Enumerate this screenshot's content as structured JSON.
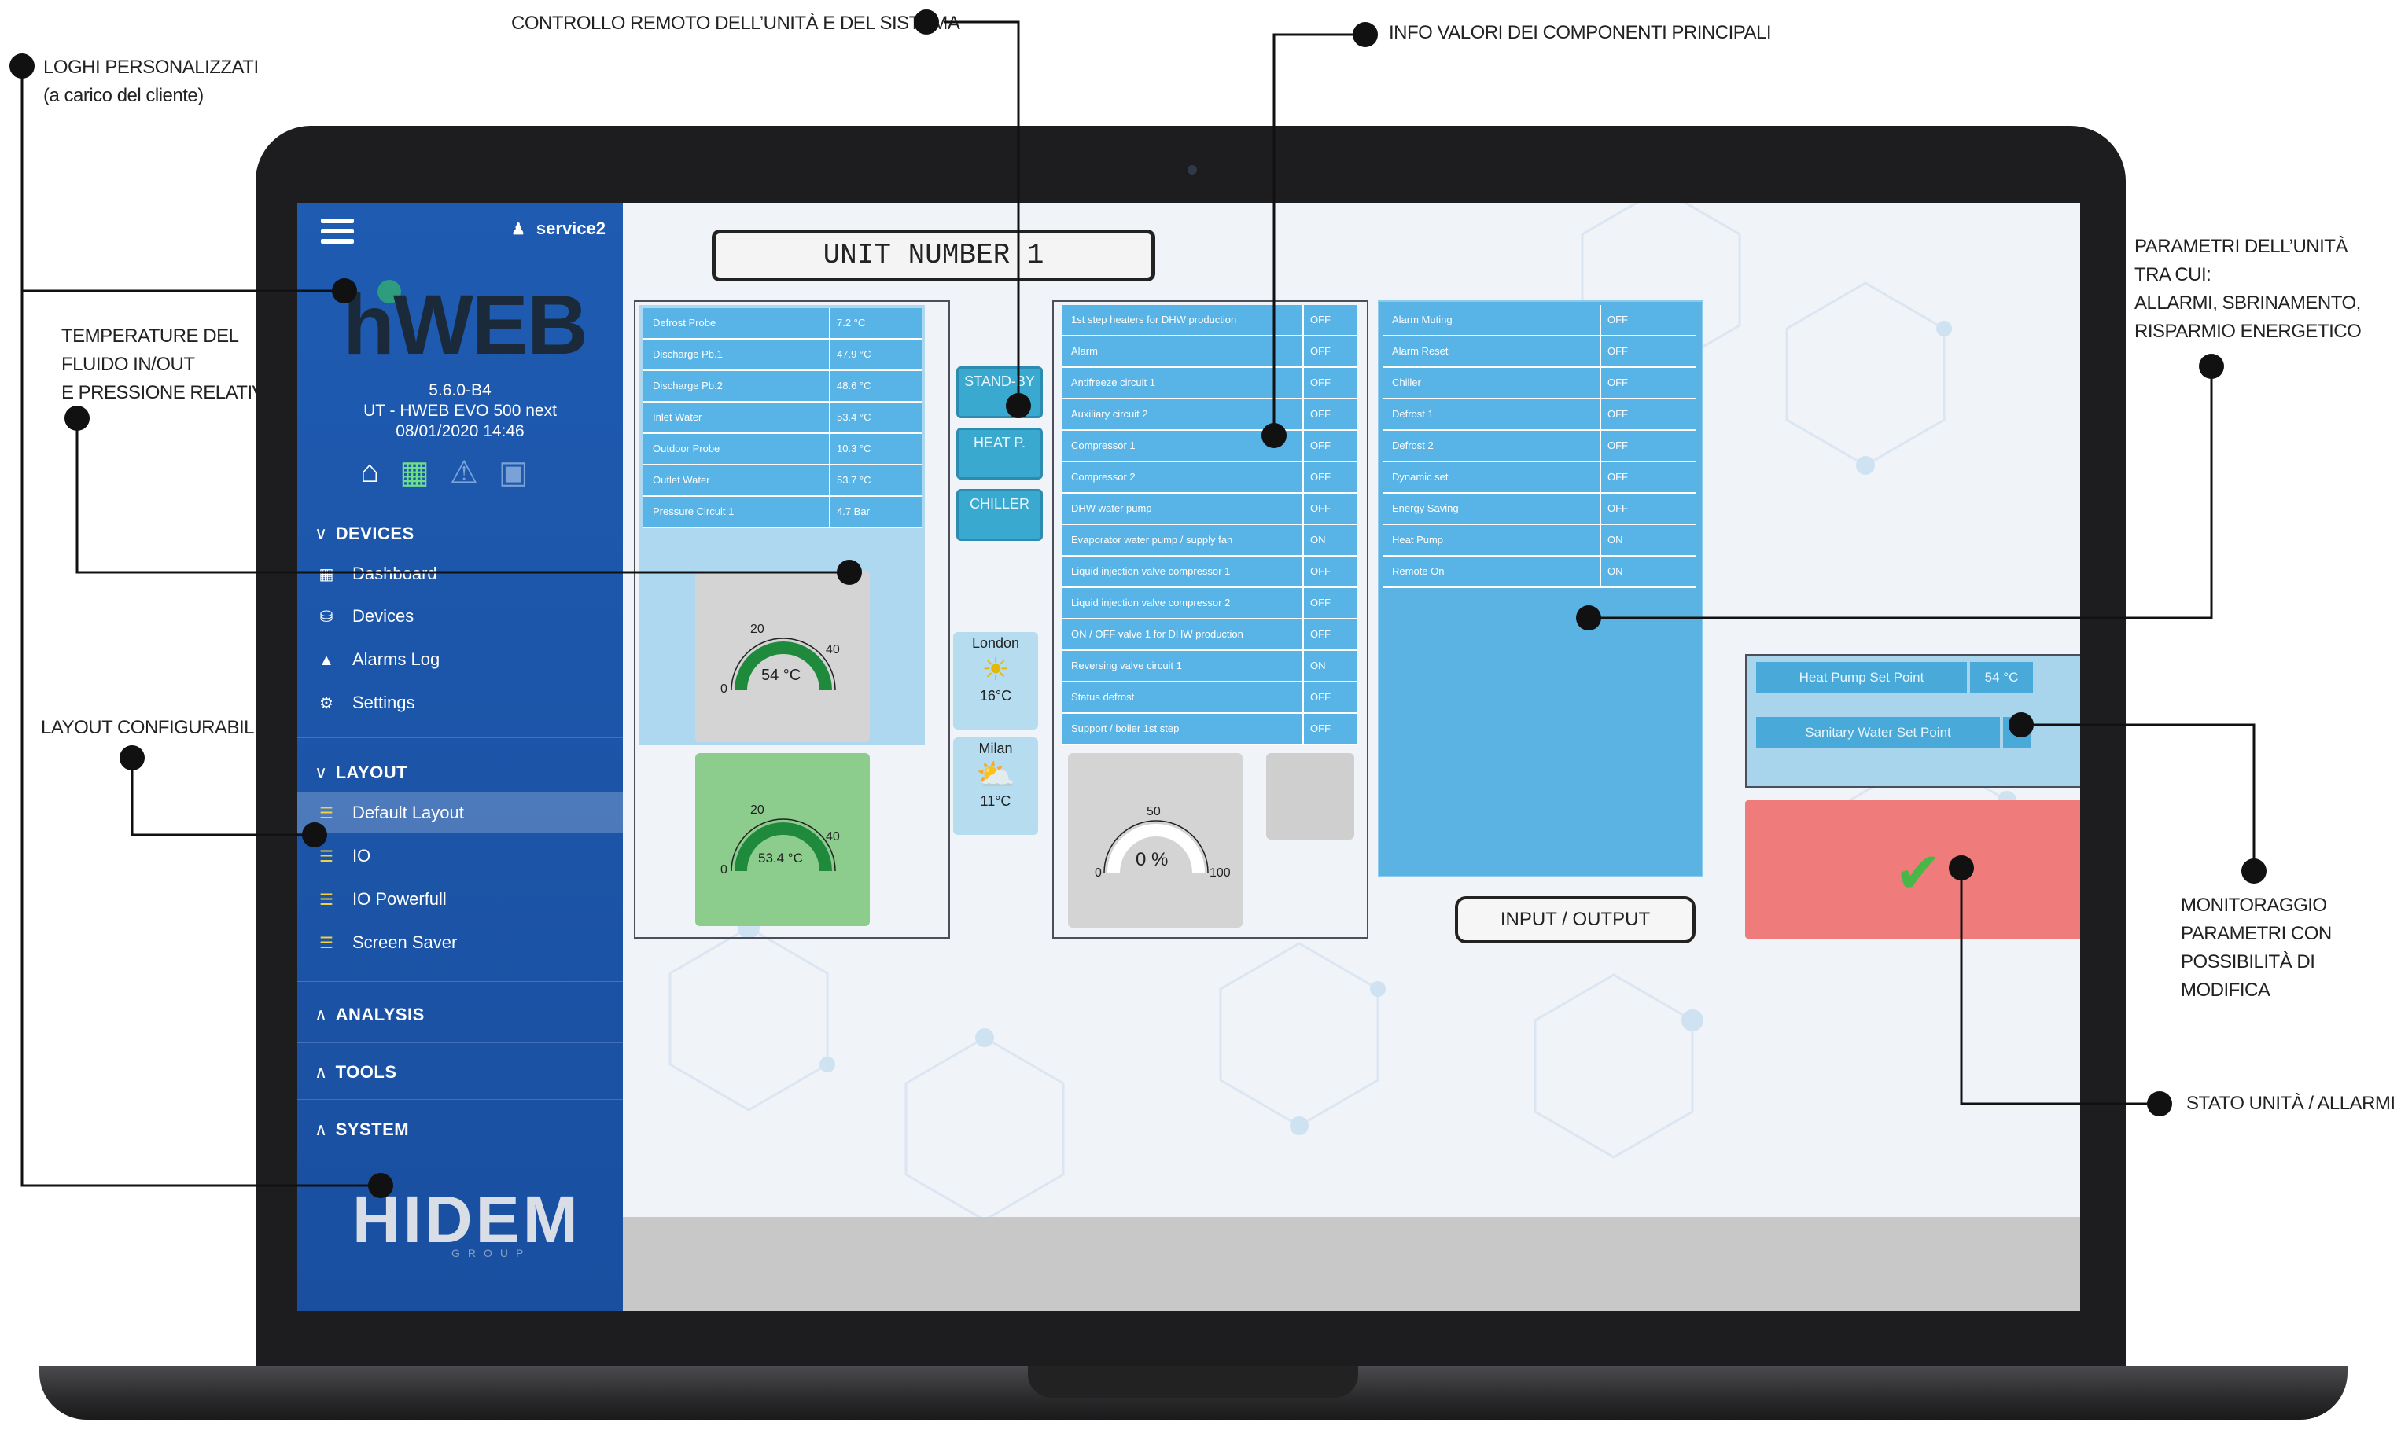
{
  "callouts": {
    "loghi_line1": "LOGHI PERSONALIZZATI",
    "loghi_line2": "(a carico del cliente)",
    "controllo": "CONTROLLO REMOTO DELL’UNITÀ E DEL  SISTEMA",
    "info": "INFO VALORI DEI COMPONENTI PRINCIPALI",
    "temperature": "TEMPERATURE DEL\nFLUIDO IN/OUT\nE PRESSIONE RELATIVA",
    "layout": "LAYOUT CONFIGURABILE",
    "parametri": "PARAMETRI DELL’UNITÀ\nTRA CUI:\nALLARMI, SBRINAMENTO,\nRISPARMIO ENERGETICO",
    "monitoraggio": "MONITORAGGIO\n PARAMETRI CON\nPOSSIBILITÀ DI MODIFICA",
    "stato": "STATO UNITÀ / ALLARMI"
  },
  "sidebar": {
    "user": "service2",
    "logo": "hWEB",
    "version": "5.6.0-B4",
    "device": "UT - HWEB EVO 500 next",
    "datetime": "08/01/2020 14:46",
    "quick_icons": [
      "home-icon",
      "monitor-chart-icon",
      "warning-icon",
      "lock-icon"
    ],
    "devices_section": "DEVICES",
    "devices_items": [
      "Dashboard",
      "Devices",
      "Alarms Log",
      "Settings"
    ],
    "layout_section": "LAYOUT",
    "layout_items": [
      "Default Layout",
      "IO",
      "IO Powerfull",
      "Screen Saver"
    ],
    "analysis": "ANALYSIS",
    "tools": "TOOLS",
    "system": "SYSTEM",
    "footer_logo": "HIDEM",
    "footer_sub": "GROUP"
  },
  "main": {
    "unit_title": "UNIT NUMBER 1",
    "probes": [
      {
        "name": "Defrost Probe",
        "value": "7.2 °C"
      },
      {
        "name": "Discharge Pb.1",
        "value": "47.9 °C"
      },
      {
        "name": "Discharge Pb.2",
        "value": "48.6 °C"
      },
      {
        "name": "Inlet Water",
        "value": "53.4 °C"
      },
      {
        "name": "Outdoor Probe",
        "value": "10.3 °C"
      },
      {
        "name": "Outlet Water",
        "value": "53.7 °C"
      },
      {
        "name": "Pressure Circuit 1",
        "value": "4.7 Bar"
      }
    ],
    "gauge1": {
      "value": 54,
      "display": "54 °C",
      "min": "0",
      "mid": "20",
      "max": "40"
    },
    "gauge2": {
      "value": 53.4,
      "display": "53.4 °C",
      "min": "0",
      "mid": "20",
      "max": "40"
    },
    "gauge3": {
      "value": 0,
      "display": "0 %",
      "min": "0",
      "mid": "50",
      "max": "100"
    },
    "buttons": [
      "STAND-BY",
      "HEAT P.",
      "CHILLER"
    ],
    "weather": [
      {
        "city": "London",
        "temp": "16°C",
        "icon": "sun-icon"
      },
      {
        "city": "Milan",
        "temp": "11°C",
        "icon": "sun-cloud-icon"
      }
    ],
    "components": [
      {
        "name": "1st step heaters for DHW production",
        "value": "OFF"
      },
      {
        "name": "Alarm",
        "value": "OFF"
      },
      {
        "name": "Antifreeze circuit 1",
        "value": "OFF"
      },
      {
        "name": "Auxiliary circuit 2",
        "value": "OFF"
      },
      {
        "name": "Compressor 1",
        "value": "OFF"
      },
      {
        "name": "Compressor 2",
        "value": "OFF"
      },
      {
        "name": "DHW water pump",
        "value": "OFF"
      },
      {
        "name": "Evaporator water pump / supply fan",
        "value": "ON"
      },
      {
        "name": "Liquid injection valve compressor 1",
        "value": "OFF"
      },
      {
        "name": "Liquid injection valve compressor 2",
        "value": "OFF"
      },
      {
        "name": "ON / OFF valve 1 for DHW production",
        "value": "OFF"
      },
      {
        "name": "Reversing valve circuit 1",
        "value": "ON"
      },
      {
        "name": "Status defrost",
        "value": "OFF"
      },
      {
        "name": "Support / boiler 1st step",
        "value": "OFF"
      }
    ],
    "unit_params": [
      {
        "name": "Alarm Muting",
        "value": "OFF"
      },
      {
        "name": "Alarm Reset",
        "value": "OFF"
      },
      {
        "name": "Chiller",
        "value": "OFF"
      },
      {
        "name": "Defrost 1",
        "value": "OFF"
      },
      {
        "name": "Defrost 2",
        "value": "OFF"
      },
      {
        "name": "Dynamic set",
        "value": "OFF"
      },
      {
        "name": "Energy Saving",
        "value": "OFF"
      },
      {
        "name": "Heat Pump",
        "value": "ON"
      },
      {
        "name": "Remote On",
        "value": "ON"
      }
    ],
    "setpoints": {
      "heat_label": "Heat Pump Set Point",
      "heat_value": "54 °C",
      "sanitary_label": "Sanitary Water Set Point",
      "sanitary_value": "--"
    },
    "io_button": "INPUT / OUTPUT"
  },
  "colors": {
    "sidebar": "#1e5bb1",
    "row": "#58b4e6",
    "panel": "#aed8f0",
    "status": "#ef7b7b",
    "gauge_green": "#1f8a3c"
  }
}
